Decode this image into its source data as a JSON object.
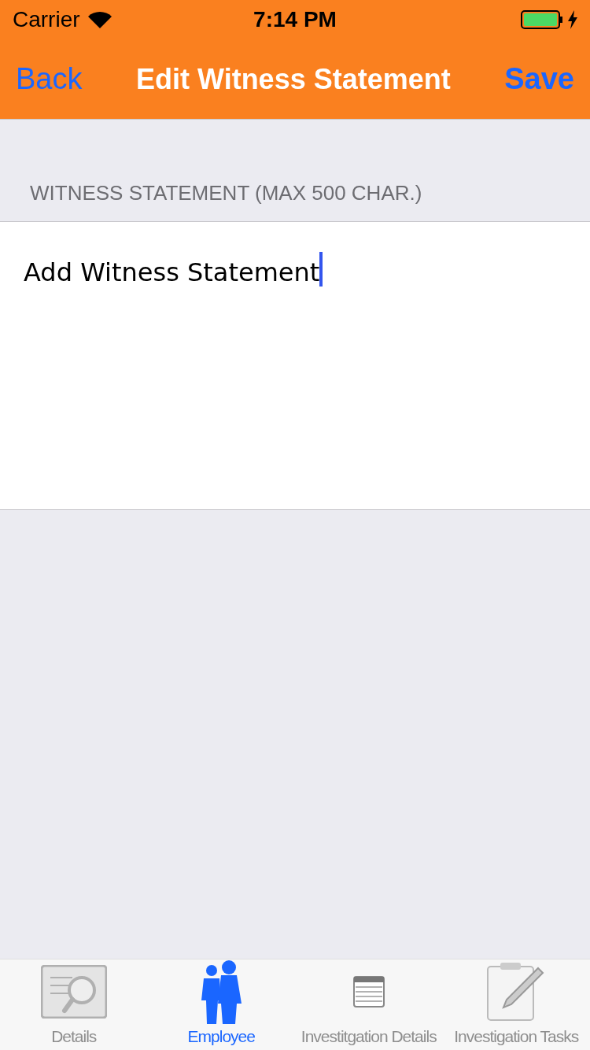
{
  "status_bar": {
    "carrier": "Carrier",
    "time": "7:14 PM"
  },
  "nav_bar": {
    "back": "Back",
    "title": "Edit Witness Statement",
    "save": "Save"
  },
  "section": {
    "header": "WITNESS STATEMENT (MAX 500 CHAR.)",
    "value": "Add Witness Statement",
    "focused": true
  },
  "tab_bar": [
    {
      "kind": "details",
      "label": "Details",
      "selected": false
    },
    {
      "kind": "employee",
      "label": "Employee",
      "selected": true
    },
    {
      "kind": "list",
      "label": "Investitgation Details",
      "selected": false
    },
    {
      "kind": "clipboard",
      "label": "Investigation Tasks",
      "selected": false
    }
  ]
}
